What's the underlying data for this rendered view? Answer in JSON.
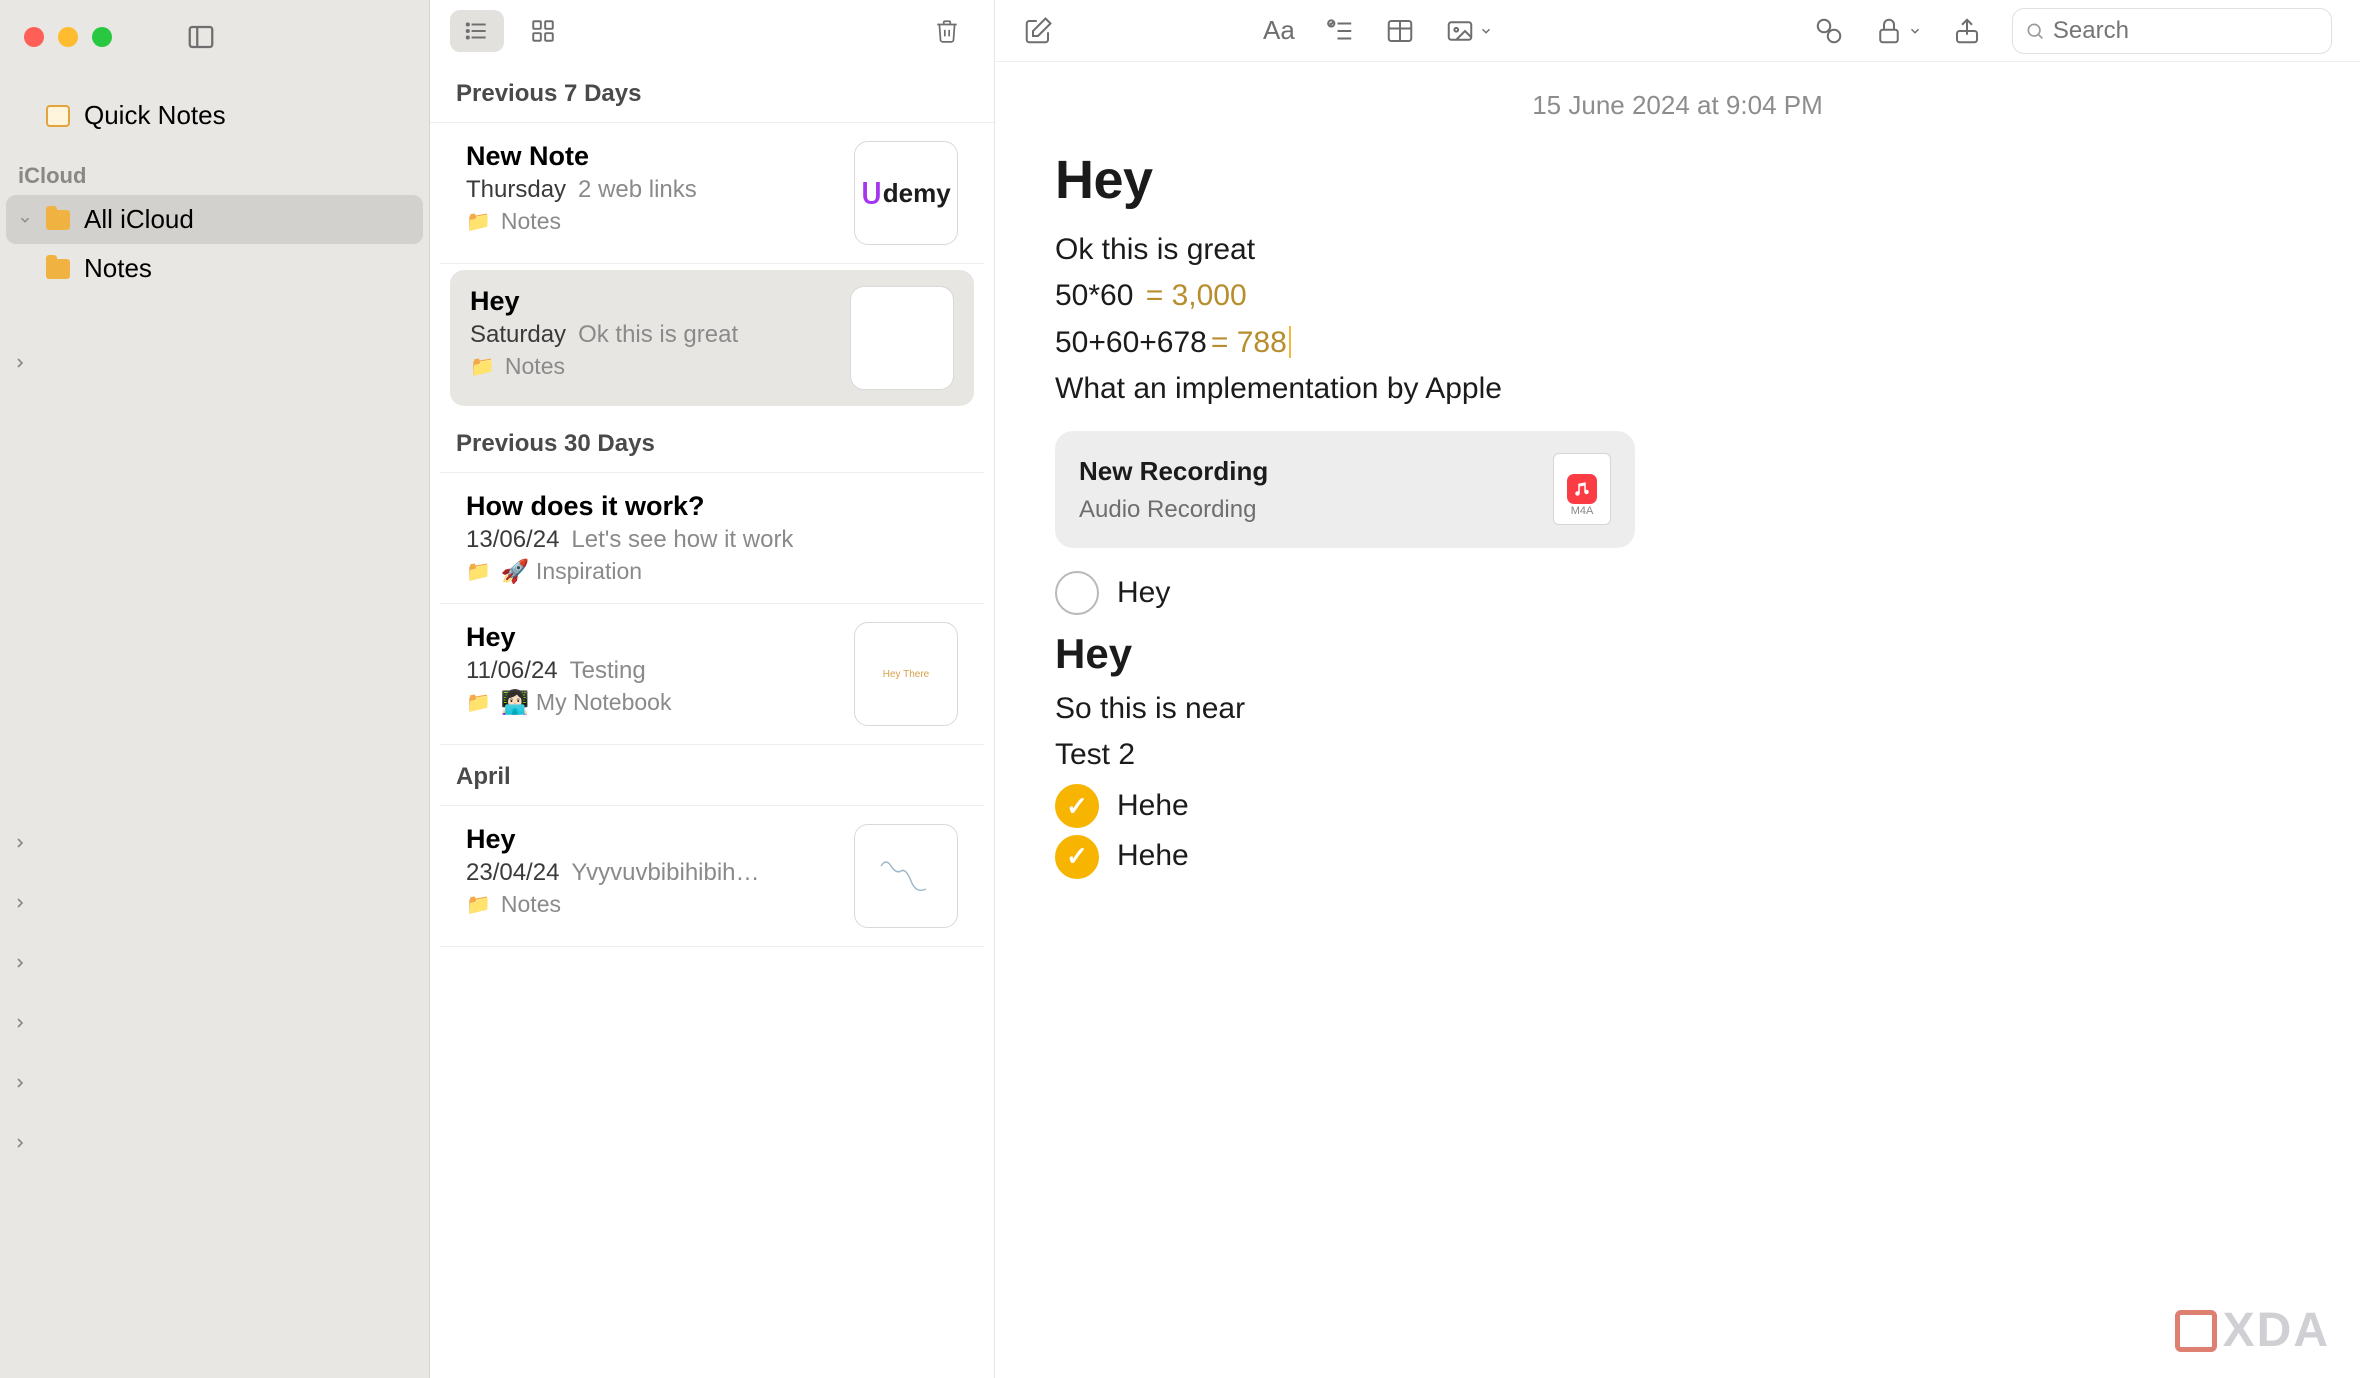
{
  "sidebar": {
    "quick_notes": "Quick Notes",
    "section": "iCloud",
    "items": [
      {
        "label": "All iCloud",
        "selected": true
      },
      {
        "label": "Notes",
        "selected": false
      }
    ]
  },
  "list": {
    "sections": [
      {
        "header": "Previous 7 Days",
        "notes": [
          {
            "title": "New Note",
            "date": "Thursday",
            "preview": "2 web links",
            "folder": "Notes",
            "thumb": "udemy",
            "selected": false
          },
          {
            "title": "Hey",
            "date": "Saturday",
            "preview": "Ok this is great",
            "folder": "Notes",
            "thumb": "blank",
            "selected": true
          }
        ]
      },
      {
        "header": "Previous 30 Days",
        "notes": [
          {
            "title": "How does it work?",
            "date": "13/06/24",
            "preview": "Let's see how it work",
            "folder": "🚀 Inspiration",
            "thumb": "",
            "selected": false
          },
          {
            "title": "Hey",
            "date": "11/06/24",
            "preview": "Testing",
            "folder": "👩🏻‍💻 My Notebook",
            "thumb": "heythere",
            "selected": false
          }
        ]
      },
      {
        "header": "April",
        "notes": [
          {
            "title": "Hey",
            "date": "23/04/24",
            "preview": "Yvyvuvbibihibih…",
            "folder": "Notes",
            "thumb": "squiggle",
            "selected": false
          }
        ]
      }
    ]
  },
  "editor": {
    "date": "15 June 2024 at 9:04 PM",
    "title": "Hey",
    "lines": {
      "l1": "Ok this is great",
      "calc1_expr": "50*60 ",
      "calc1_res": "= 3,000",
      "calc2_expr": "50+60+678",
      "calc2_res": "= 788",
      "l3": "What an implementation by Apple"
    },
    "attachment": {
      "title": "New Recording",
      "sub": "Audio Recording",
      "ext": "M4A"
    },
    "check1": "Hey",
    "subheading": "Hey",
    "p1": "So this is near",
    "p2": "Test 2",
    "done1": "Hehe",
    "done2": "Hehe"
  },
  "toolbar": {
    "search_placeholder": "Search"
  },
  "watermark": "XDA"
}
